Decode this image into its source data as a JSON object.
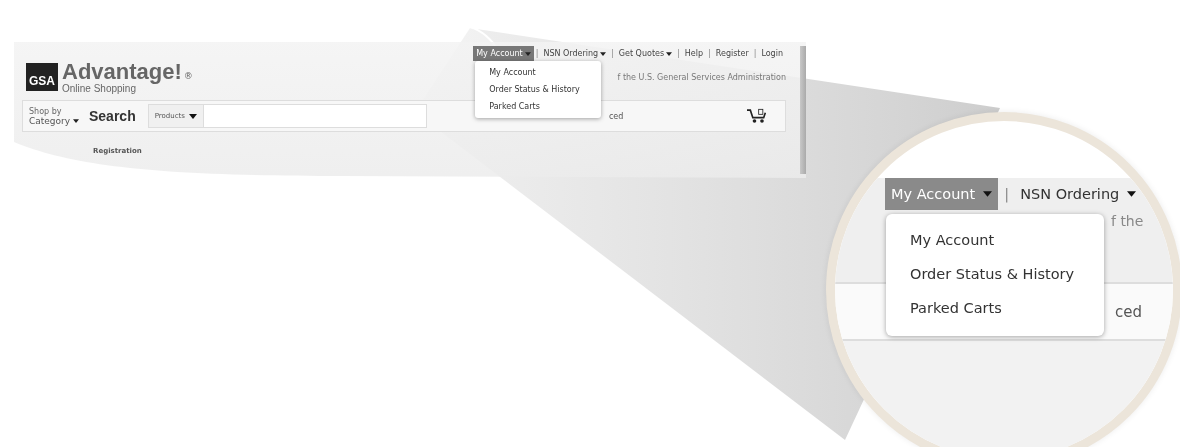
{
  "page": {
    "logo": {
      "badge": "GSA",
      "name": "Advantage!",
      "mark": "®",
      "tagline": "Online Shopping"
    },
    "nav": [
      {
        "label": "My Account",
        "dropdown": true,
        "selected": true
      },
      {
        "label": "NSN Ordering",
        "separator_before": "|",
        "dropdown": true,
        "selected": false
      },
      {
        "label": "Get Quotes",
        "separator_before": "|",
        "dropdown": true,
        "selected": false
      },
      {
        "label": "Help",
        "separator_before": "|",
        "dropdown": false,
        "selected": false
      },
      {
        "label": "Register",
        "separator_before": "|",
        "dropdown": false,
        "selected": false
      },
      {
        "label": "Login",
        "separator_before": "|",
        "dropdown": false,
        "selected": false
      }
    ],
    "menu": [
      "My Account",
      "Order Status & History",
      "Parked Carts"
    ],
    "subtitle": "f the U.S. General Services Administration",
    "search": {
      "shop_by": "Shop by",
      "category": "Category",
      "label": "Search",
      "scope": "Products",
      "advanced": "ced"
    },
    "registration": "Registration"
  },
  "magnifier": {
    "nav": [
      {
        "label": "My Account",
        "selected": true
      },
      {
        "label": "NSN Ordering",
        "separator_before": "|",
        "selected": false
      }
    ],
    "menu": [
      "My Account",
      "Order Status & History",
      "Parked Carts"
    ],
    "subtitle": "f the",
    "advanced": "ced"
  }
}
